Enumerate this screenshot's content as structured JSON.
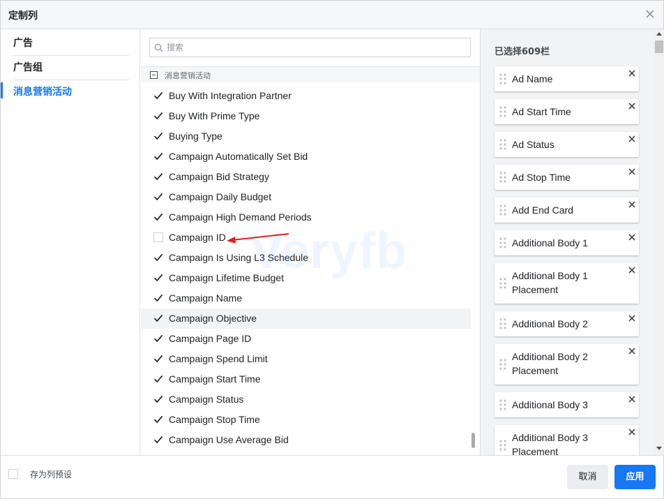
{
  "dialog": {
    "title": "定制列"
  },
  "left_nav": {
    "items": [
      {
        "label": "广告",
        "active": false
      },
      {
        "label": "广告组",
        "active": false
      },
      {
        "label": "消息营销活动",
        "active": true
      }
    ]
  },
  "search": {
    "placeholder": "搜索",
    "value": ""
  },
  "section": {
    "label": "消息营销活动",
    "state": "expanded"
  },
  "columns": [
    {
      "label": "Buy With Integration Partner",
      "checked": true
    },
    {
      "label": "Buy With Prime Type",
      "checked": true
    },
    {
      "label": "Buying Type",
      "checked": true
    },
    {
      "label": "Campaign Automatically Set Bid",
      "checked": true
    },
    {
      "label": "Campaign Bid Strategy",
      "checked": true
    },
    {
      "label": "Campaign Daily Budget",
      "checked": true
    },
    {
      "label": "Campaign High Demand Periods",
      "checked": true
    },
    {
      "label": "Campaign ID",
      "checked": false
    },
    {
      "label": "Campaign Is Using L3 Schedule",
      "checked": true
    },
    {
      "label": "Campaign Lifetime Budget",
      "checked": true
    },
    {
      "label": "Campaign Name",
      "checked": true
    },
    {
      "label": "Campaign Objective",
      "checked": true,
      "hover": true
    },
    {
      "label": "Campaign Page ID",
      "checked": true
    },
    {
      "label": "Campaign Spend Limit",
      "checked": true
    },
    {
      "label": "Campaign Start Time",
      "checked": true
    },
    {
      "label": "Campaign Status",
      "checked": true
    },
    {
      "label": "Campaign Stop Time",
      "checked": true
    },
    {
      "label": "Campaign Use Average Bid",
      "checked": true
    }
  ],
  "selected_panel": {
    "title": "已选择609栏",
    "items": [
      {
        "label": "Ad Name"
      },
      {
        "label": "Ad Start Time"
      },
      {
        "label": "Ad Status"
      },
      {
        "label": "Ad Stop Time"
      },
      {
        "label": "Add End Card"
      },
      {
        "label": "Additional Body 1"
      },
      {
        "label": "Additional Body 1 Placement"
      },
      {
        "label": "Additional Body 2"
      },
      {
        "label": "Additional Body 2 Placement"
      },
      {
        "label": "Additional Body 3"
      },
      {
        "label": "Additional Body 3 Placement"
      }
    ]
  },
  "watermark": "Veryfb",
  "footer": {
    "save_preset_label": "存为列预设",
    "save_preset_checked": false,
    "cancel_label": "取消",
    "apply_label": "应用"
  },
  "colors": {
    "accent": "#1877f2",
    "annotation_arrow": "#e02020"
  },
  "icons": {
    "close": "close-icon",
    "search": "search-icon",
    "check": "checkmark-icon",
    "collapse": "minus-icon",
    "drag": "drag-handle-icon",
    "remove": "remove-x-icon"
  }
}
